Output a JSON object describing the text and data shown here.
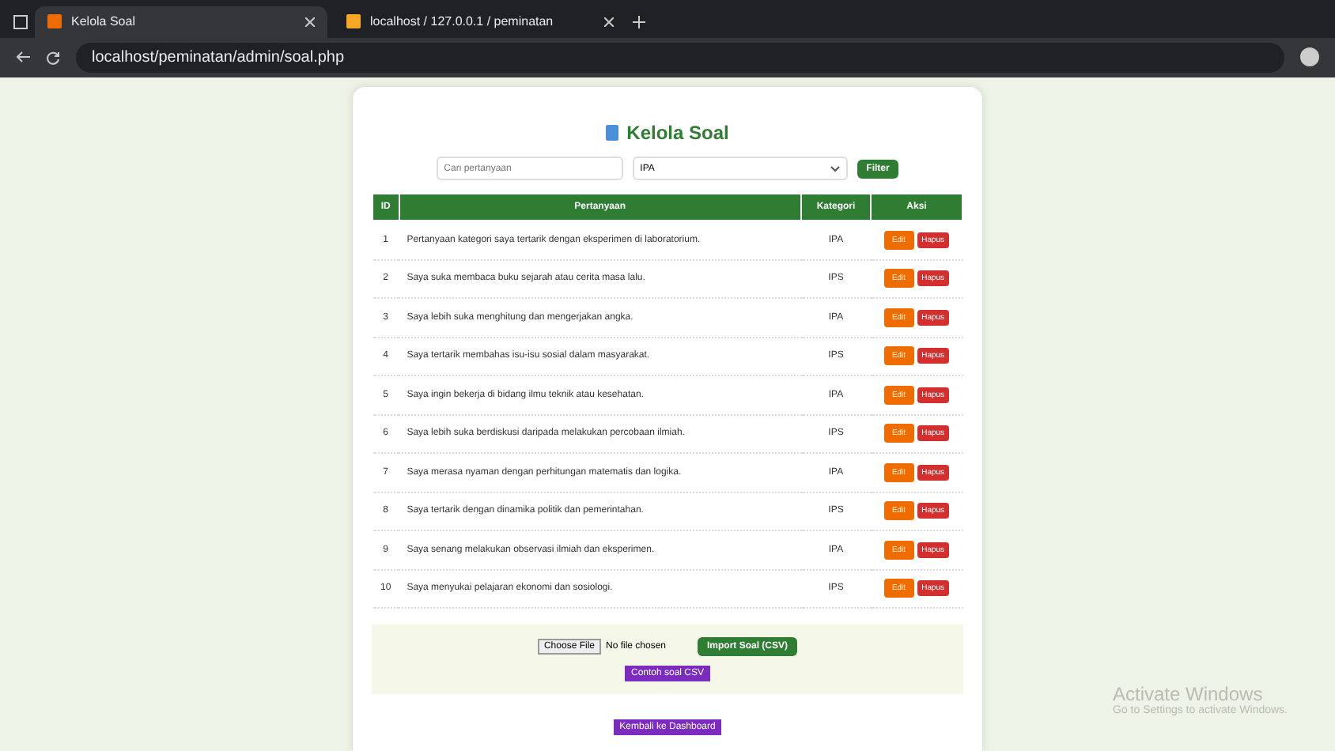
{
  "browser": {
    "tabs": [
      {
        "title": "Kelola Soal",
        "selected": true
      },
      {
        "title": "localhost / 127.0.0.1 / peminatan",
        "selected": false
      }
    ],
    "url": "localhost/peminatan/admin/soal.php"
  },
  "page": {
    "title": "Kelola Soal",
    "filter": {
      "placeholder": "Cari pertanyaan",
      "category": "IPA",
      "button": "Filter"
    },
    "table": {
      "columns": [
        "ID",
        "Pertanyaan",
        "Kategori",
        "Aksi"
      ],
      "rows": [
        {
          "id": "1",
          "question": "Pertanyaan kategori saya tertarik dengan eksperimen di laboratorium.",
          "category": "IPA"
        },
        {
          "id": "2",
          "question": "Saya suka membaca buku sejarah atau cerita masa lalu.",
          "category": "IPS"
        },
        {
          "id": "3",
          "question": "Saya lebih suka menghitung dan mengerjakan angka.",
          "category": "IPA"
        },
        {
          "id": "4",
          "question": "Saya tertarik membahas isu-isu sosial dalam masyarakat.",
          "category": "IPS"
        },
        {
          "id": "5",
          "question": "Saya ingin bekerja di bidang ilmu teknik atau kesehatan.",
          "category": "IPA"
        },
        {
          "id": "6",
          "question": "Saya lebih suka berdiskusi daripada melakukan percobaan ilmiah.",
          "category": "IPS"
        },
        {
          "id": "7",
          "question": "Saya merasa nyaman dengan perhitungan matematis dan logika.",
          "category": "IPA"
        },
        {
          "id": "8",
          "question": "Saya tertarik dengan dinamika politik dan pemerintahan.",
          "category": "IPS"
        },
        {
          "id": "9",
          "question": "Saya senang melakukan observasi ilmiah dan eksperimen.",
          "category": "IPA"
        },
        {
          "id": "10",
          "question": "Saya menyukai pelajaran ekonomi dan sosiologi.",
          "category": "IPS"
        }
      ],
      "actions": [
        {
          "edit": "Edit",
          "delete": "Hapus"
        },
        {
          "edit": "Edit",
          "delete": "Hapus"
        },
        {
          "edit": "Edit",
          "delete": "Hapus"
        },
        {
          "edit": "Edit",
          "delete": "Hapus"
        },
        {
          "edit": "Edit",
          "delete": "Hapus"
        },
        {
          "edit": "Edit",
          "delete": "Hapus"
        },
        {
          "edit": "Edit",
          "delete": "Hapus"
        },
        {
          "edit": "Edit",
          "delete": "Hapus"
        },
        {
          "edit": "Edit",
          "delete": "Hapus"
        },
        {
          "edit": "Edit",
          "delete": "Hapus"
        }
      ]
    },
    "import": {
      "choose": "Choose File",
      "no_file": "No file chosen",
      "button": "Import Soal (CSV)",
      "template": "Contoh soal CSV"
    },
    "back": "Kembali ke Dashboard"
  },
  "os_notice": {
    "title": "Activate Windows",
    "text": "Go to Settings to activate Windows."
  }
}
